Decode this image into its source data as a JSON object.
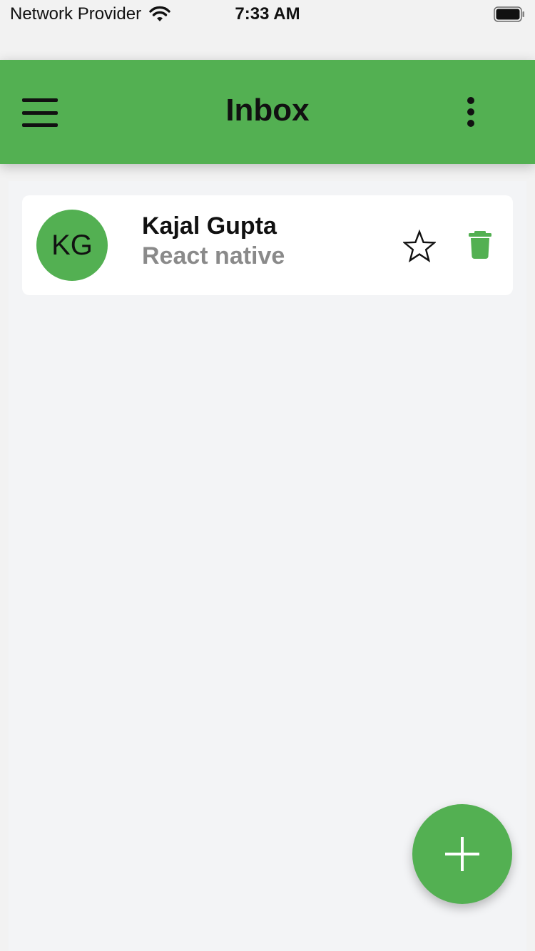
{
  "status_bar": {
    "carrier": "Network Provider",
    "time": "7:33 AM",
    "icons": [
      "wifi-icon",
      "battery-icon"
    ]
  },
  "header": {
    "title": "Inbox",
    "left_icon": "menu-icon",
    "right_icon": "more-vertical-icon",
    "color": "#53b052"
  },
  "emails": [
    {
      "initials": "KG",
      "sender": "Kajal Gupta",
      "subject": "React native",
      "starred": false,
      "icons": [
        "star-outline-icon",
        "trash-icon"
      ]
    }
  ],
  "fab": {
    "icon": "plus-icon"
  },
  "colors": {
    "accent": "#53b052",
    "subject_text": "#8a8a8a",
    "background": "#f2f2f2"
  }
}
